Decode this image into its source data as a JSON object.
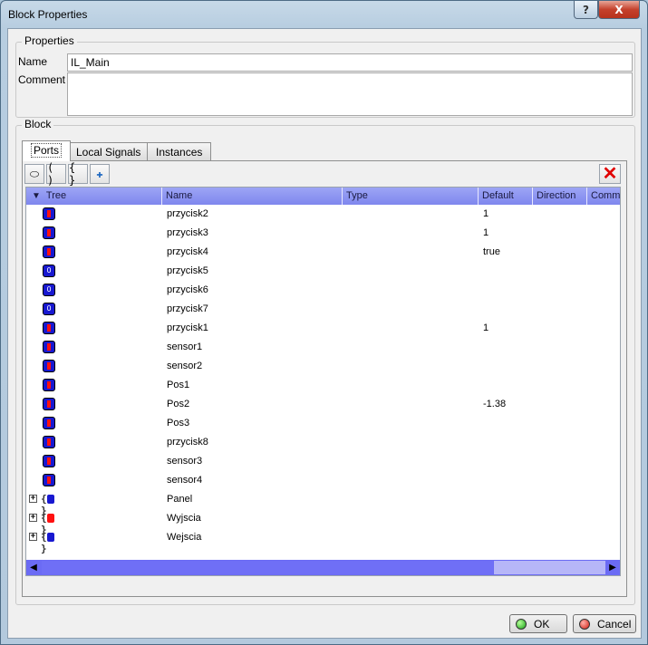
{
  "window": {
    "title": "Block Properties",
    "help_glyph": "?",
    "close_glyph": "X"
  },
  "properties": {
    "legend": "Properties",
    "name_label": "Name",
    "name_value": "IL_Main",
    "comment_label": "Comment",
    "comment_value": ""
  },
  "block": {
    "legend": "Block",
    "tabs": [
      {
        "label": "Ports",
        "active": true
      },
      {
        "label": "Local Signals",
        "active": false
      },
      {
        "label": "Instances",
        "active": false
      }
    ],
    "toolbar": [
      {
        "icon": "oval-icon",
        "glyph": "⬭"
      },
      {
        "icon": "parentheses-icon",
        "glyph": "( )"
      },
      {
        "icon": "braces-icon",
        "glyph": "{ }"
      },
      {
        "icon": "add-type-icon",
        "glyph": "✚"
      }
    ],
    "delete_glyph": "✕",
    "columns": [
      "Tree",
      "Name",
      "Type",
      "Default",
      "Direction",
      "Comm"
    ],
    "sort_glyph": "▼",
    "rows": [
      {
        "icon": "inout",
        "name": "przycisk2",
        "type": "",
        "default": "1"
      },
      {
        "icon": "inout",
        "name": "przycisk3",
        "type": "",
        "default": "1"
      },
      {
        "icon": "inout",
        "name": "przycisk4",
        "type": "",
        "default": "true"
      },
      {
        "icon": "input",
        "name": "przycisk5",
        "type": "",
        "default": ""
      },
      {
        "icon": "input",
        "name": "przycisk6",
        "type": "",
        "default": ""
      },
      {
        "icon": "input",
        "name": "przycisk7",
        "type": "",
        "default": ""
      },
      {
        "icon": "inout",
        "name": "przycisk1",
        "type": "",
        "default": "1"
      },
      {
        "icon": "inout",
        "name": "sensor1",
        "type": "",
        "default": ""
      },
      {
        "icon": "inout",
        "name": "sensor2",
        "type": "",
        "default": ""
      },
      {
        "icon": "inout",
        "name": "Pos1",
        "type": "",
        "default": ""
      },
      {
        "icon": "inout",
        "name": "Pos2",
        "type": "",
        "default": "-1.38"
      },
      {
        "icon": "inout",
        "name": "Pos3",
        "type": "",
        "default": ""
      },
      {
        "icon": "inout",
        "name": "przycisk8",
        "type": "",
        "default": ""
      },
      {
        "icon": "inout",
        "name": "sensor3",
        "type": "",
        "default": ""
      },
      {
        "icon": "inout",
        "name": "sensor4",
        "type": "",
        "default": ""
      },
      {
        "icon": "group-blue",
        "name": "Panel",
        "type": "",
        "default": ""
      },
      {
        "icon": "group-red",
        "name": "Wyjscia",
        "type": "",
        "default": ""
      },
      {
        "icon": "group-blue",
        "name": "Wejscia",
        "type": "",
        "default": ""
      }
    ],
    "input_glyph": "0",
    "expand_glyph": "+",
    "scroll_left_glyph": "◀",
    "scroll_right_glyph": "▶"
  },
  "buttons": {
    "ok": "OK",
    "cancel": "Cancel"
  },
  "colors": {
    "header_bg": "#8088f0",
    "icon_blue": "#1818d0",
    "icon_red": "#ff1010",
    "scrollbar": "#6b6bf4"
  }
}
